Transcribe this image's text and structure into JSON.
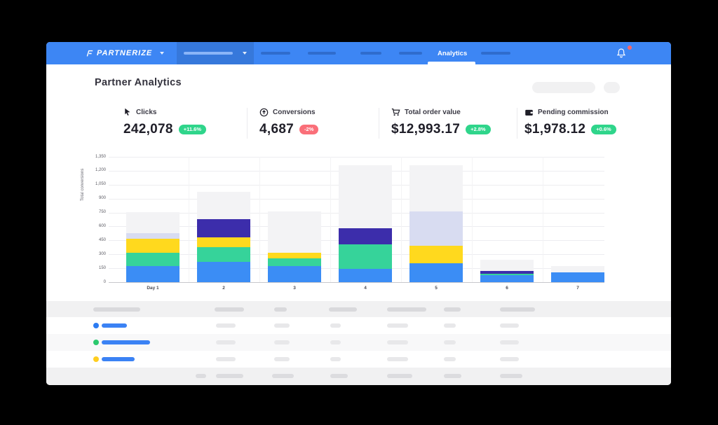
{
  "nav": {
    "brand": "PARTNERIZE",
    "active_tab": "Analytics"
  },
  "header": {
    "title": "Partner Analytics"
  },
  "kpis": [
    {
      "icon": "cursor-icon",
      "label": "Clicks",
      "value": "242,078",
      "change": "+11.6%",
      "trend": "up"
    },
    {
      "icon": "arrow-up-circle-icon",
      "label": "Conversions",
      "value": "4,687",
      "change": "-2%",
      "trend": "down"
    },
    {
      "icon": "cart-icon",
      "label": "Total order value",
      "value": "$12,993.17",
      "change": "+2.8%",
      "trend": "up"
    },
    {
      "icon": "wallet-icon",
      "label": "Pending commission",
      "value": "$1,978.12",
      "change": "+0.6%",
      "trend": "up"
    }
  ],
  "colors": {
    "nav_blue": "#3d86f4",
    "trend_up": "#2fd58b",
    "trend_down": "#fa6f79",
    "link_blue": "#3b82f4"
  },
  "chart_data": {
    "type": "bar",
    "stacked": true,
    "title": "",
    "xlabel": "",
    "ylabel": "Total conversions",
    "ylim": [
      0,
      1350
    ],
    "ytick_labels": [
      "0",
      "150",
      "300",
      "450",
      "600",
      "750",
      "900",
      "1,050",
      "1,200",
      "1,350"
    ],
    "categories": [
      "Day 1",
      "2",
      "3",
      "4",
      "5",
      "6",
      "7"
    ],
    "series_colors": {
      "blue": "#3b8df5",
      "green": "#36d39a",
      "yellow": "#ffd91e",
      "indigo": "#3c2dab",
      "lavender": "#d8dcf1",
      "gray": "#f3f3f5"
    },
    "bars": [
      {
        "category": "Day 1",
        "segments": [
          [
            "blue",
            175
          ],
          [
            "green",
            145
          ],
          [
            "yellow",
            145
          ],
          [
            "lavender",
            60
          ],
          [
            "gray",
            230
          ]
        ]
      },
      {
        "category": "2",
        "segments": [
          [
            "blue",
            220
          ],
          [
            "green",
            160
          ],
          [
            "yellow",
            100
          ],
          [
            "indigo",
            200
          ],
          [
            "gray",
            290
          ]
        ]
      },
      {
        "category": "3",
        "segments": [
          [
            "blue",
            170
          ],
          [
            "green",
            90
          ],
          [
            "yellow",
            60
          ],
          [
            "gray",
            445
          ]
        ]
      },
      {
        "category": "4",
        "segments": [
          [
            "blue",
            145
          ],
          [
            "green",
            265
          ],
          [
            "indigo",
            170
          ],
          [
            "gray",
            680
          ]
        ]
      },
      {
        "category": "5",
        "segments": [
          [
            "blue",
            205
          ],
          [
            "yellow",
            185
          ],
          [
            "lavender",
            375
          ],
          [
            "gray",
            495
          ]
        ]
      },
      {
        "category": "6",
        "segments": [
          [
            "blue",
            75
          ],
          [
            "green",
            15
          ],
          [
            "indigo",
            30
          ],
          [
            "gray",
            125
          ]
        ]
      },
      {
        "category": "7",
        "segments": [
          [
            "blue",
            105
          ],
          [
            "gray",
            65
          ]
        ]
      }
    ],
    "grid": true,
    "legend": "none"
  },
  "table": {
    "rows": [
      {
        "dot_color": "#2c7bf2",
        "link_width": 36
      },
      {
        "dot_color": "#2bc96e",
        "link_width": 69
      },
      {
        "dot_color": "#ffce1f",
        "link_width": 47
      }
    ]
  }
}
